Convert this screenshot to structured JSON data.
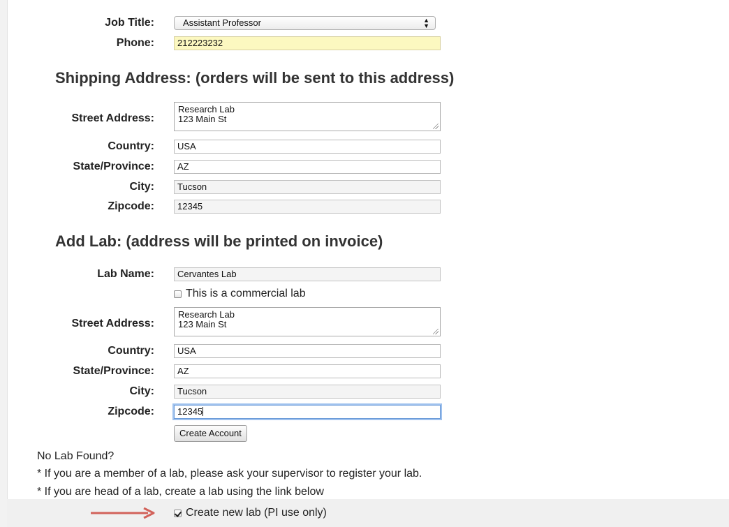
{
  "personal": {
    "job_title_label": "Job Title:",
    "job_title_value": "Assistant Professor",
    "phone_label": "Phone:",
    "phone_value": "212223232"
  },
  "shipping": {
    "heading": "Shipping Address: (orders will be sent to this address)",
    "street_label": "Street Address:",
    "street_line1": "Research Lab",
    "street_line2": "123 Main St",
    "country_label": "Country:",
    "country_value": "USA",
    "state_label": "State/Province:",
    "state_value": "AZ",
    "city_label": "City:",
    "city_value": "Tucson",
    "zip_label": "Zipcode:",
    "zip_value": "12345"
  },
  "lab": {
    "heading": "Add Lab: (address will be printed on invoice)",
    "name_label": "Lab Name:",
    "name_value": "Cervantes Lab",
    "commercial_label": "This is a commercial lab",
    "commercial_checked": false,
    "street_label": "Street Address:",
    "street_line1": "Research Lab",
    "street_line2": "123 Main St",
    "country_label": "Country:",
    "country_value": "USA",
    "state_label": "State/Province:",
    "state_value": "AZ",
    "city_label": "City:",
    "city_value": "Tucson",
    "zip_label": "Zipcode:",
    "zip_value": "12345"
  },
  "actions": {
    "create_account_label": "Create Account"
  },
  "notes": {
    "no_lab_found": "No Lab Found?",
    "member_note": "* If you are a member of a lab, please ask your supervisor to register your lab.",
    "head_note": "* If you are head of a lab, create a lab using the link below"
  },
  "footer": {
    "create_lab_label": "Create new lab (PI use only)",
    "create_lab_checked": true
  },
  "colors": {
    "arrow": "#d2625a",
    "focus_ring": "#9ec1ee",
    "autofill_yellow": "#fcf8c0"
  }
}
